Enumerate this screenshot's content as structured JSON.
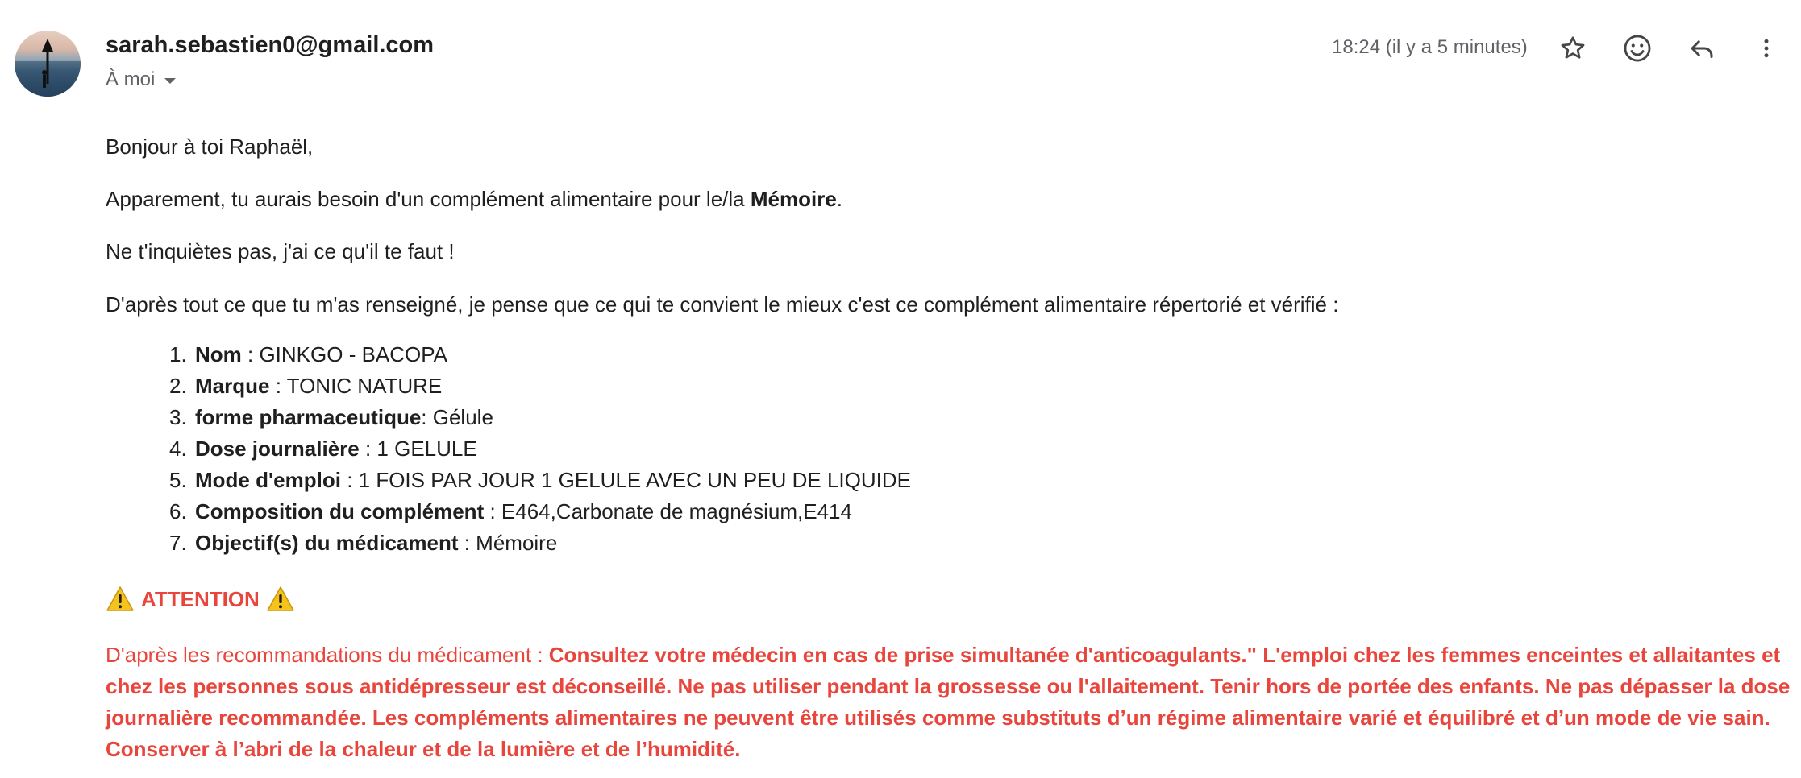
{
  "email": {
    "sender": "sarah.sebastien0@gmail.com",
    "recipient_label": "À moi",
    "timestamp": "18:24 (il y a 5 minutes)"
  },
  "icons": {
    "avatar": "sender-avatar",
    "star": "star-icon",
    "emoji": "emoji-reaction-icon",
    "reply": "reply-icon",
    "more": "more-vert-icon",
    "warning": "warning-sign-icon"
  },
  "message": {
    "greeting": "Bonjour à toi Raphaël,",
    "need_prefix": "Apparement, tu aurais besoin d'un complément alimentaire pour le/la ",
    "need_subject": "Mémoire",
    "need_suffix": ".",
    "reassure": "Ne t'inquiètes pas, j'ai ce qu'il te faut !",
    "intro": "D'après tout ce que tu m'as renseigné, je pense que ce qui te convient le mieux c'est ce complément alimentaire répertorié et vérifié :",
    "details": [
      {
        "num": "1.",
        "label": "Nom",
        "sep": " : ",
        "value": "GINKGO - BACOPA"
      },
      {
        "num": "2.",
        "label": "Marque",
        "sep": " : ",
        "value": "TONIC NATURE"
      },
      {
        "num": "3.",
        "label": "forme pharmaceutique",
        "sep": ": ",
        "value": "Gélule"
      },
      {
        "num": "4.",
        "label": "Dose journalière",
        "sep": " : ",
        "value": "1 GELULE"
      },
      {
        "num": "5.",
        "label": "Mode d'emploi",
        "sep": " : ",
        "value": "1 FOIS PAR JOUR 1 GELULE AVEC UN PEU DE LIQUIDE"
      },
      {
        "num": "6.",
        "label": "Composition du complément",
        "sep": " : ",
        "value": "E464,Carbonate de magnésium,E414"
      },
      {
        "num": "7.",
        "label": "Objectif(s) du médicament",
        "sep": " : ",
        "value": "Mémoire"
      }
    ],
    "attention_label": "ATTENTION",
    "warning_intro": "D'après les recommandations du médicament : ",
    "warning_text": "Consultez votre médecin en cas de prise simultanée d'anticoagulants.\" L'emploi chez les femmes enceintes et allaitantes et chez les personnes sous antidépresseur est déconseillé. Ne pas utiliser pendant la grossesse ou l'allaitement. Tenir hors de portée des enfants. Ne pas dépasser la dose journalière recommandée. Les compléments alimentaires ne peuvent être utilisés comme substituts d’un régime alimentaire varié et équilibré et d’un mode de vie sain. Conserver à l’abri de la chaleur et de la lumière et de l’humidité."
  },
  "colors": {
    "warning": "#e8453c",
    "muted": "#5f6368",
    "text": "#1f1f1f"
  }
}
